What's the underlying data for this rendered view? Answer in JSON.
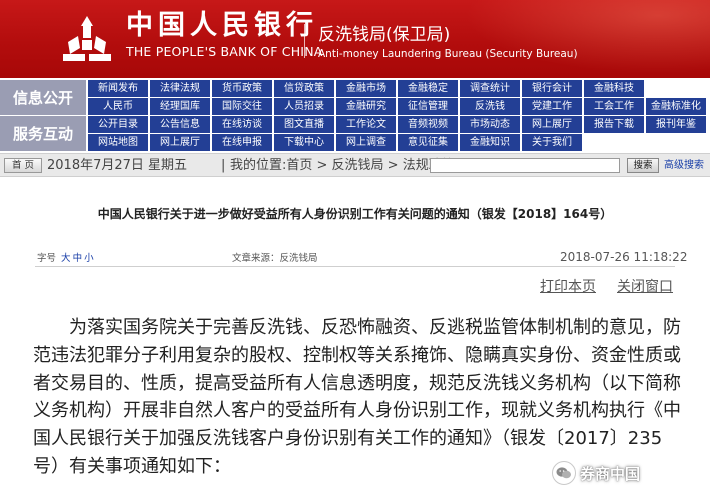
{
  "header": {
    "bank_name_cn": "中国人民银行",
    "bank_name_en": "THE PEOPLE'S BANK OF CHINA",
    "bureau_cn": "反洗钱局(保卫局)",
    "bureau_en": "Anti-money Laundering Bureau (Security Bureau)"
  },
  "nav": {
    "group1_label": "信息公开",
    "group2_label": "服务互动",
    "rows": [
      [
        "新闻发布",
        "法律法规",
        "货币政策",
        "信贷政策",
        "金融市场",
        "金融稳定",
        "调查统计",
        "银行会计",
        "金融科技"
      ],
      [
        "人民币",
        "经理国库",
        "国际交往",
        "人员招录",
        "金融研究",
        "征信管理",
        "反洗钱",
        "党建工作",
        "工会工作",
        "金融标准化"
      ],
      [
        "公开目录",
        "公告信息",
        "在线访谈",
        "图文直播",
        "工作论文",
        "音频视频",
        "市场动态",
        "网上展厅",
        "报告下载",
        "报刊年鉴"
      ],
      [
        "网站地图",
        "网上展厅",
        "在线申报",
        "下载中心",
        "网上调查",
        "意见征集",
        "金融知识",
        "关于我们"
      ]
    ]
  },
  "breadcrumb": {
    "home_label": "首 页",
    "date": "2018年7月27日 星期五",
    "location": "我的位置:首页 > 反洗钱局 > 法规政策",
    "search_button": "搜索",
    "advanced_search": "高级搜索"
  },
  "article": {
    "title": "中国人民银行关于进一步做好受益所有人身份识别工作有关问题的通知（银发【2018】164号）",
    "font_size_label": "字号",
    "font_sizes": [
      "大",
      "中",
      "小"
    ],
    "source_label": "文章来源：反洗钱局",
    "datetime": "2018-07-26 11:18:22",
    "print_link": "打印本页",
    "close_link": "关闭窗口",
    "body": "为落实国务院关于完善反洗钱、反恐怖融资、反逃税监管体制机制的意见，防范违法犯罪分子利用复杂的股权、控制权等关系掩饰、隐瞒真实身份、资金性质或者交易目的、性质，提高受益所有人信息透明度，规范反洗钱义务机构（以下简称义务机构）开展非自然人客户的受益所有人身份识别工作，现就义务机构执行《中国人民银行关于加强反洗钱客户身份识别有关工作的通知》（银发〔2017〕235号）有关事项通知如下："
  },
  "watermark": {
    "text": "券商中国"
  },
  "colors": {
    "header_red": "#b30d0d",
    "nav_blue": "#233f95",
    "nav_tag_gray": "#9a9db3",
    "link_blue": "#1a3fa8"
  }
}
